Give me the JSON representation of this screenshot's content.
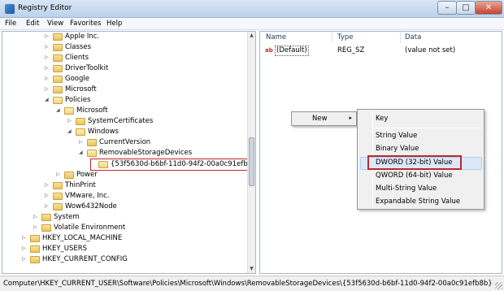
{
  "window": {
    "title": "Registry Editor",
    "minimize": "–",
    "maximize": "□",
    "close": "✕"
  },
  "menu": [
    "File",
    "Edit",
    "View",
    "Favorites",
    "Help"
  ],
  "tree": [
    {
      "label": "Apple Inc.",
      "expander": "▷"
    },
    {
      "label": "Classes",
      "expander": "▷"
    },
    {
      "label": "Clients",
      "expander": "▷"
    },
    {
      "label": "DriverToolkit",
      "expander": "▷"
    },
    {
      "label": "Google",
      "expander": "▷"
    },
    {
      "label": "Microsoft",
      "expander": "▷"
    },
    {
      "label": "Policies",
      "expander": "◢"
    },
    {
      "label": "Microsoft",
      "expander": "◢"
    },
    {
      "label": "SystemCertificates",
      "expander": "▷"
    },
    {
      "label": "Windows",
      "expander": "◢"
    },
    {
      "label": "CurrentVersion",
      "expander": "▷"
    },
    {
      "label": "RemovableStorageDevices",
      "expander": "◢"
    },
    {
      "label": "{53f5630d-b6bf-11d0-94f2-00a0c91efb8b}",
      "expander": ""
    },
    {
      "label": "Power",
      "expander": "▷"
    },
    {
      "label": "ThinPrint",
      "expander": "▷"
    },
    {
      "label": "VMware, Inc.",
      "expander": "▷"
    },
    {
      "label": "Wow6432Node",
      "expander": "▷"
    },
    {
      "label": "System",
      "expander": "▷"
    },
    {
      "label": "Volatile Environment",
      "expander": "▷"
    },
    {
      "label": "HKEY_LOCAL_MACHINE",
      "expander": "▷"
    },
    {
      "label": "HKEY_USERS",
      "expander": "▷"
    },
    {
      "label": "HKEY_CURRENT_CONFIG",
      "expander": "▷"
    }
  ],
  "list": {
    "headers": {
      "name": "Name",
      "type": "Type",
      "data": "Data"
    },
    "rows": [
      {
        "icon": "ab",
        "name": "(Default)",
        "type": "REG_SZ",
        "data": "(value not set)"
      }
    ]
  },
  "context_menu": {
    "new_label": "New",
    "arrow": "▸"
  },
  "submenu": {
    "items": [
      "Key",
      "String Value",
      "Binary Value",
      "DWORD (32-bit) Value",
      "QWORD (64-bit) Value",
      "Multi-String Value",
      "Expandable String Value"
    ]
  },
  "status": {
    "path": "Computer\\HKEY_CURRENT_USER\\Software\\Policies\\Microsoft\\Windows\\RemovableStorageDevices\\{53f5630d-b6bf-11d0-94f2-00a0c91efb8b}"
  },
  "colors": {
    "highlight_box": "#c0282d",
    "menu_highlight": "#dce8f8",
    "folder": "#f2d47c"
  }
}
